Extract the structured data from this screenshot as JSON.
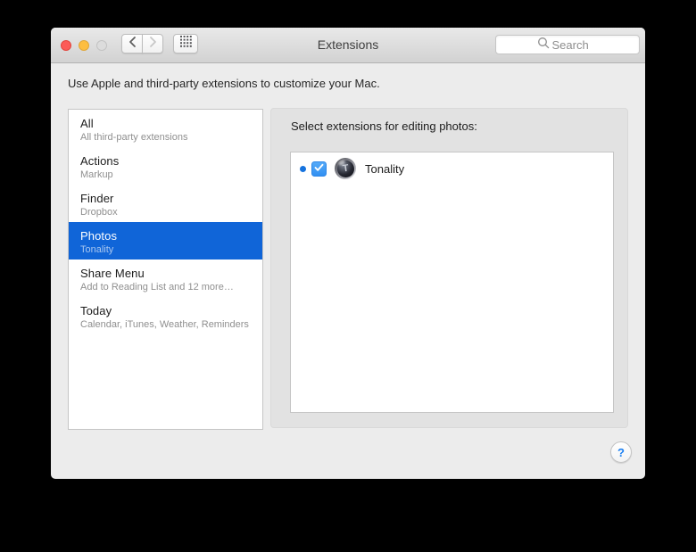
{
  "window": {
    "title": "Extensions",
    "intro": "Use Apple and third-party extensions to customize your Mac."
  },
  "titlebar": {
    "search_placeholder": "Search"
  },
  "sidebar": {
    "items": [
      {
        "title": "All",
        "subtitle": "All third-party extensions",
        "selected": false
      },
      {
        "title": "Actions",
        "subtitle": "Markup",
        "selected": false
      },
      {
        "title": "Finder",
        "subtitle": "Dropbox",
        "selected": false
      },
      {
        "title": "Photos",
        "subtitle": "Tonality",
        "selected": true
      },
      {
        "title": "Share Menu",
        "subtitle": "Add to Reading List and 12 more…",
        "selected": false
      },
      {
        "title": "Today",
        "subtitle": "Calendar, iTunes, Weather, Reminders",
        "selected": false
      }
    ]
  },
  "panel": {
    "label": "Select extensions for editing photos:",
    "extensions": [
      {
        "name": "Tonality",
        "icon_letter": "T",
        "checked": true,
        "update_dot": true
      }
    ]
  },
  "help": {
    "label": "?"
  },
  "colors": {
    "selection_blue": "#1065d8",
    "checkbox_blue": "#3f9bf5",
    "update_dot_blue": "#1673de",
    "help_blue": "#1a7ff2",
    "window_background": "#ececec",
    "panel_background": "#e2e2e2"
  }
}
